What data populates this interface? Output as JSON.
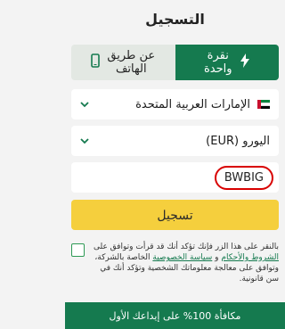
{
  "title": "التسجيل",
  "tabs": [
    {
      "label": "عن طريق\nالهاتف",
      "icon": "phone-icon"
    },
    {
      "label": "نقرة\nواحدة",
      "icon": "lightning-icon"
    }
  ],
  "country": {
    "value": "الإمارات العربية المتحدة",
    "icon": "uae-flag-icon"
  },
  "currency": {
    "value": "اليورو (EUR)"
  },
  "promo_code": {
    "value": "BWBIG"
  },
  "submit_label": "تسجيل",
  "consent": {
    "part1": "بالنقر على هذا الزر فإنك تؤكد أنك قد قرأت وتوافق على ",
    "terms_link": "الشروط والأحكام",
    "and": " و ",
    "privacy_link": "سياسة الخصوصية",
    "part2": " الخاصة بالشركة، وتوافق على معالجة معلوماتك الشخصية وتؤكد أنك في سن قانونية."
  },
  "bonus_text": "مكافأة 100% على إيداعك الأول",
  "colors": {
    "primary_green": "#157a4f",
    "accent_yellow": "#f5cf3d",
    "highlight_red": "#d80000"
  }
}
